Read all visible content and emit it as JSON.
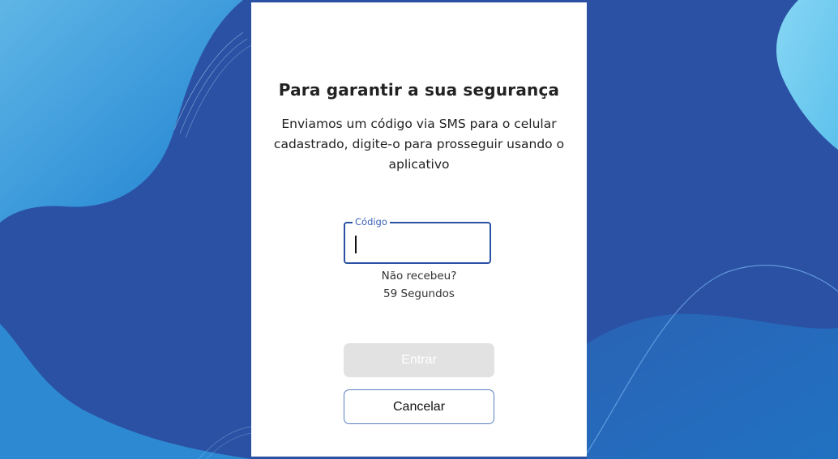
{
  "dialog": {
    "title": "Para garantir a sua segurança",
    "description": "Enviamos um código via SMS para o celular cadastrado, digite-o para prosseguir usando o aplicativo"
  },
  "code_field": {
    "label": "Código",
    "value": "",
    "placeholder": ""
  },
  "resend": {
    "question": "Não recebeu?",
    "countdown": "59 Segundos"
  },
  "buttons": {
    "enter_label": "Entrar",
    "cancel_label": "Cancelar"
  },
  "colors": {
    "background": "#2a51a3",
    "accent_light": "#7fcff0",
    "field_border": "#2a51a3",
    "disabled_button": "#e2e2e2"
  }
}
